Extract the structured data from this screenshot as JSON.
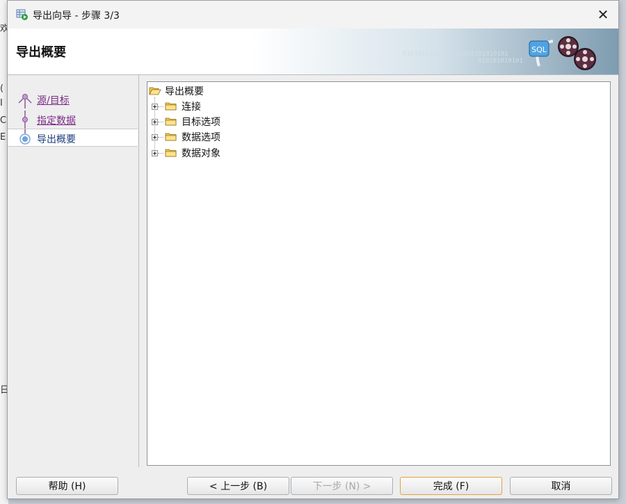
{
  "background_fragments": [
    "欢",
    "(",
    "I",
    "C",
    "E",
    "日"
  ],
  "window": {
    "title": "导出向导 - 步骤 3/3",
    "close_glyph": "✕"
  },
  "header": {
    "title": "导出概要",
    "binary_line1": "0101010101010101010101010101",
    "binary_line2": "010101010101",
    "art_label": "SQL"
  },
  "steps": [
    {
      "label": "源/目标",
      "state": "visited"
    },
    {
      "label": "指定数据",
      "state": "visited"
    },
    {
      "label": "导出概要",
      "state": "current"
    }
  ],
  "tree": {
    "root": "导出概要",
    "children": [
      "连接",
      "目标选项",
      "数据选项",
      "数据对象"
    ]
  },
  "buttons": {
    "help": "帮助 (H)",
    "back": "< 上一步 (B)",
    "next": "下一步 (N) >",
    "finish": "完成 (F)",
    "cancel": "取消"
  },
  "colors": {
    "link_visited": "#7a2a86",
    "current_step": "#1d3f7a",
    "default_button_border": "#e3a33c",
    "folder": "#f2c94c"
  }
}
